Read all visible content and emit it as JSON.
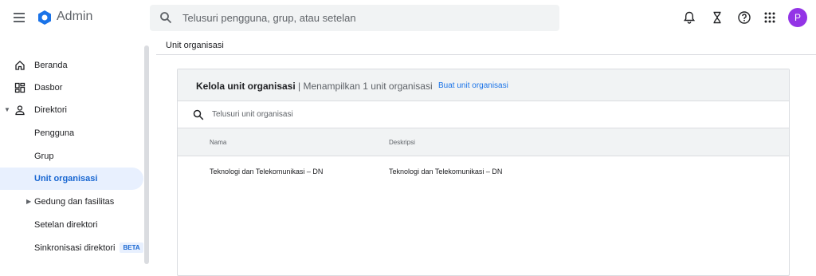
{
  "header": {
    "app_title": "Admin",
    "search_placeholder": "Telusuri pengguna, grup, atau setelan",
    "avatar_initial": "P",
    "icons": [
      "menu-icon",
      "admin-logo-icon",
      "search-icon",
      "bell-icon",
      "hourglass-icon",
      "help-icon",
      "apps-icon"
    ]
  },
  "sidebar": {
    "items": [
      {
        "label": "Beranda",
        "icon": "home-icon"
      },
      {
        "label": "Dasbor",
        "icon": "dashboard-icon"
      },
      {
        "label": "Direktori",
        "icon": "person-icon",
        "expanded": true
      },
      {
        "label": "Pengguna"
      },
      {
        "label": "Grup"
      },
      {
        "label": "Unit organisasi",
        "active": true
      },
      {
        "label": "Gedung dan fasilitas",
        "collapsed": true
      },
      {
        "label": "Setelan direktori"
      },
      {
        "label": "Sinkronisasi direktori",
        "badge": "BETA"
      }
    ]
  },
  "breadcrumb": {
    "label": "Unit organisasi"
  },
  "card": {
    "title": "Kelola unit organisasi",
    "subtitle": "Menampilkan 1 unit organisasi",
    "separator": "|",
    "create_link": "Buat unit organisasi",
    "search_placeholder": "Telusuri unit organisasi",
    "columns": [
      "Nama",
      "Deskripsi"
    ],
    "rows": [
      {
        "name": "Teknologi dan Telekomunikasi – DN",
        "description": "Teknologi dan Telekomunikasi – DN"
      }
    ]
  },
  "colors": {
    "accent": "#1a73e8",
    "active_bg": "#e8f0fe",
    "avatar_bg": "#9334e6",
    "logo_blue": "#1a73e8"
  }
}
